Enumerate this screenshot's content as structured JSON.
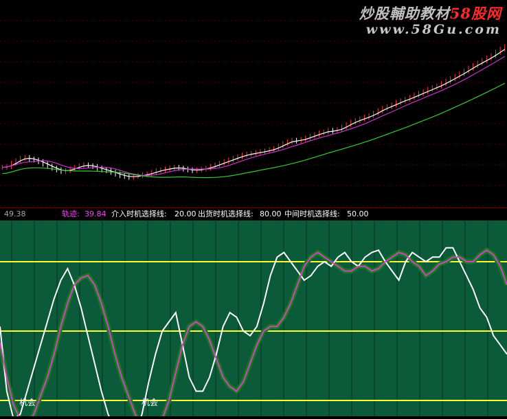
{
  "watermark": {
    "brand_prefix": "炒股輔助教材",
    "brand_accent": "58股网",
    "url": "www.58Gu.com"
  },
  "price_panel": {
    "price_label": "49.38",
    "colors": {
      "up_candle": "#ff3333",
      "down_candle": "#ffffff",
      "ma_fast": "#ffffff",
      "ma_mid": "#cc33cc",
      "ma_slow": "#33cc33",
      "grid": "#550000"
    },
    "closes": [
      52,
      54,
      62,
      68,
      74,
      76,
      72,
      70,
      66,
      60,
      55,
      50,
      46,
      42,
      44,
      48,
      52,
      56,
      58,
      56,
      54,
      50,
      46,
      44,
      40,
      36,
      32,
      30,
      28,
      30,
      32,
      34,
      36,
      40,
      44,
      46,
      48,
      50,
      52,
      50,
      48,
      46,
      44,
      46,
      48,
      50,
      54,
      58,
      62,
      66,
      70,
      74,
      78,
      82,
      84,
      86,
      88,
      90,
      92,
      95,
      98,
      104,
      110,
      114,
      118,
      116,
      120,
      124,
      128,
      132,
      136,
      138,
      142,
      140,
      144,
      150,
      156,
      162,
      166,
      170,
      174,
      178,
      184,
      190,
      196,
      200,
      204,
      210,
      214,
      218,
      222,
      228,
      232,
      236,
      242,
      246,
      250,
      256,
      262,
      268,
      274,
      280,
      286,
      294,
      300,
      306,
      312,
      318,
      324,
      332,
      340,
      346
    ]
  },
  "indicator_bar": {
    "track_label": "轨迹:",
    "track_value": "39.84",
    "entry_label": "介入时机选择线:",
    "entry_value": "20.00",
    "exit_label": "出货时机选择线:",
    "exit_value": "80.00",
    "mid_label": "中间时机选择线:",
    "mid_value": "50.00",
    "colors": {
      "price": "#b0b0b0",
      "track": "#ff40ff",
      "lines": "#ffffff"
    }
  },
  "indicator_panel": {
    "background": "#0b5a3a",
    "level_lines": [
      80,
      50,
      20
    ],
    "level_color": "#ffff33",
    "signals": [
      {
        "text": "机会",
        "index": 7
      },
      {
        "text": "机会",
        "index": 52
      }
    ],
    "track_values": [
      45,
      30,
      18,
      12,
      10,
      14,
      22,
      30,
      40,
      52,
      62,
      70,
      73,
      74,
      70,
      62,
      52,
      40,
      30,
      22,
      14,
      8,
      6,
      8,
      12,
      20,
      32,
      44,
      52,
      54,
      52,
      46,
      38,
      30,
      26,
      24,
      28,
      36,
      44,
      50,
      52,
      52,
      56,
      62,
      70,
      78,
      82,
      84,
      82,
      80,
      78,
      76,
      76,
      78,
      78,
      76,
      77,
      80,
      82,
      84,
      83,
      80,
      78,
      74,
      76,
      79,
      80,
      82,
      82,
      80,
      80,
      83,
      85,
      83,
      78,
      70
    ],
    "white_values": [
      52,
      24,
      12,
      14,
      24,
      34,
      44,
      54,
      64,
      72,
      77,
      70,
      60,
      48,
      36,
      24,
      14,
      8,
      5,
      4,
      6,
      14,
      28,
      40,
      50,
      54,
      58,
      44,
      30,
      24,
      24,
      30,
      40,
      52,
      58,
      56,
      50,
      48,
      52,
      62,
      74,
      82,
      84,
      80,
      76,
      72,
      74,
      78,
      80,
      78,
      82,
      84,
      80,
      78,
      82,
      84,
      85,
      80,
      76,
      72,
      80,
      84,
      82,
      80,
      82,
      82,
      86,
      86,
      80,
      74,
      68,
      60,
      56,
      48,
      44,
      40
    ]
  }
}
